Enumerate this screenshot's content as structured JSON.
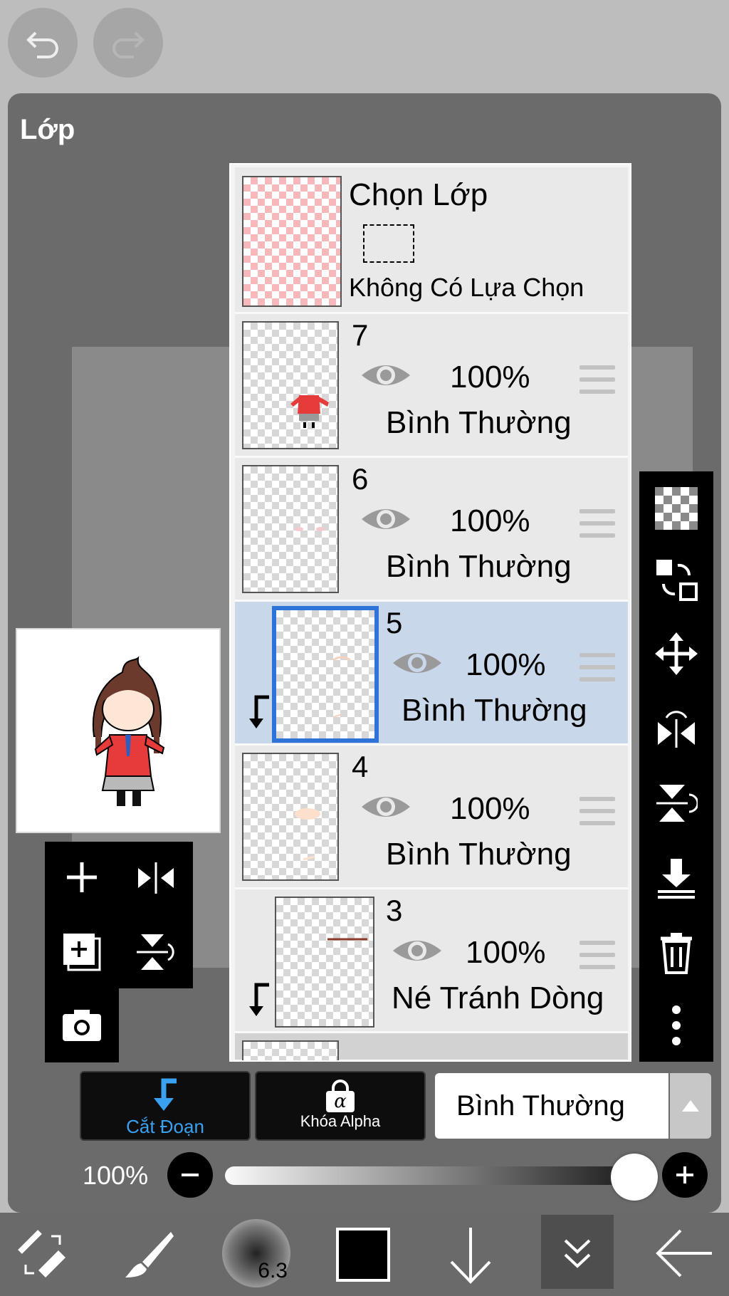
{
  "header": {
    "undo_icon": "undo-icon",
    "redo_icon": "redo-icon"
  },
  "panel": {
    "title": "Lớp"
  },
  "selection_layer": {
    "title": "Chọn Lớp",
    "status": "Không Có Lựa Chọn"
  },
  "layers": [
    {
      "number": "7",
      "opacity": "100%",
      "blend": "Bình Thường",
      "clipped": false,
      "selected": false
    },
    {
      "number": "6",
      "opacity": "100%",
      "blend": "Bình Thường",
      "clipped": false,
      "selected": false
    },
    {
      "number": "5",
      "opacity": "100%",
      "blend": "Bình Thường",
      "clipped": true,
      "selected": true
    },
    {
      "number": "4",
      "opacity": "100%",
      "blend": "Bình Thường",
      "clipped": false,
      "selected": false
    },
    {
      "number": "3",
      "opacity": "100%",
      "blend": "Né Tránh Dòng",
      "clipped": true,
      "selected": false
    }
  ],
  "controls": {
    "clip_label": "Cắt Đoạn",
    "alpha_label": "Khóa Alpha",
    "alpha_symbol": "α",
    "blend_mode": "Bình Thường",
    "opacity_label": "100%",
    "opacity_value": 1.0
  },
  "bottom_bar": {
    "brush_size": "6.3",
    "color": "#000000"
  },
  "colors": {
    "accent": "#2e73d8",
    "clip_blue": "#3aa0f0",
    "selected_row": "#c9d7ea"
  }
}
